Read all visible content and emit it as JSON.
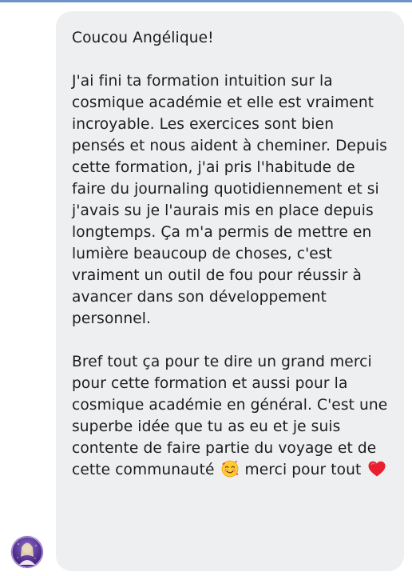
{
  "message": {
    "greeting": "Coucou Angélique!",
    "paragraph_1": "J'ai fini ta formation intuition sur la cosmique académie et elle est vraiment incroyable. Les exercices sont bien pensés et nous aident à cheminer. Depuis cette formation, j'ai pris l'habitude de faire du journaling quotidiennement et si j'avais su je l'aurais mis en place depuis longtemps. Ça m'a permis de mettre en lumière beaucoup de choses, c'est vraiment un outil de fou pour réussir à avancer dans son développement personnel.",
    "paragraph_2_part_1": "Bref tout ça pour te dire un grand merci pour cette formation et aussi pour la cosmique académie en général. C'est une superbe idée que tu as eu et je suis contente de faire partie du voyage et de cette communauté",
    "paragraph_2_part_2": "merci pour tout",
    "emoji_1": "smiling-face-with-hearts",
    "emoji_2": "red-heart"
  },
  "colors": {
    "bubble_background": "#eeeff1",
    "text": "#1c1c1e",
    "top_edge": "#6e93c8"
  }
}
